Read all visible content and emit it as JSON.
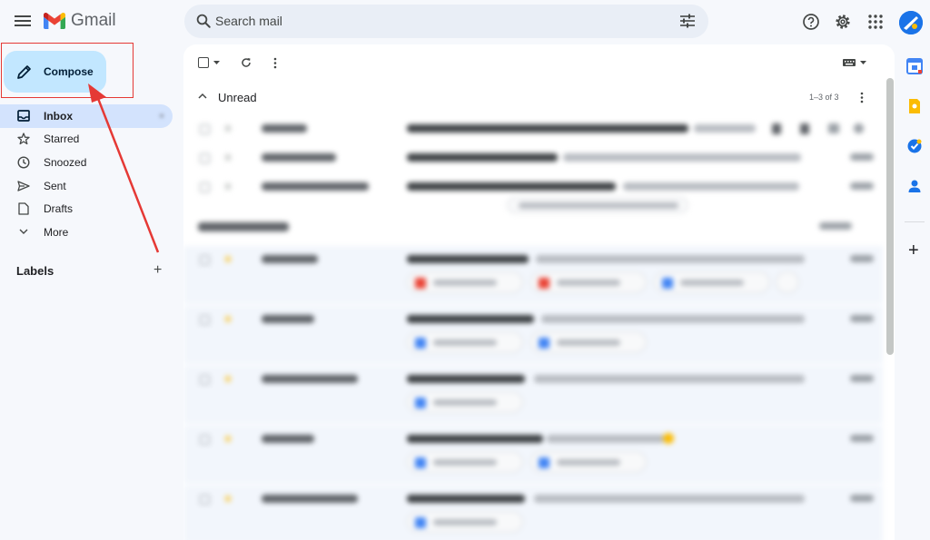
{
  "app": {
    "name": "Gmail"
  },
  "search": {
    "placeholder": "Search mail"
  },
  "compose": {
    "label": "Compose"
  },
  "sidebar": {
    "items": [
      {
        "id": "inbox",
        "label": "Inbox",
        "icon": "inbox-icon",
        "active": true
      },
      {
        "id": "starred",
        "label": "Starred",
        "icon": "star-icon"
      },
      {
        "id": "snoozed",
        "label": "Snoozed",
        "icon": "clock-icon"
      },
      {
        "id": "sent",
        "label": "Sent",
        "icon": "send-icon"
      },
      {
        "id": "drafts",
        "label": "Drafts",
        "icon": "draft-icon"
      },
      {
        "id": "more",
        "label": "More",
        "icon": "chevron-down-icon"
      }
    ],
    "labels_title": "Labels"
  },
  "sections": {
    "unread": {
      "title": "Unread",
      "range": "1–3 of 3"
    }
  },
  "colors": {
    "compose_bg": "#c2e7ff",
    "active_nav": "#d3e3fd",
    "annotation": "#e53935",
    "gmail_red": "#ea4335",
    "gmail_blue": "#4285f4",
    "gmail_green": "#34a853",
    "gmail_yellow": "#fbbc04"
  }
}
